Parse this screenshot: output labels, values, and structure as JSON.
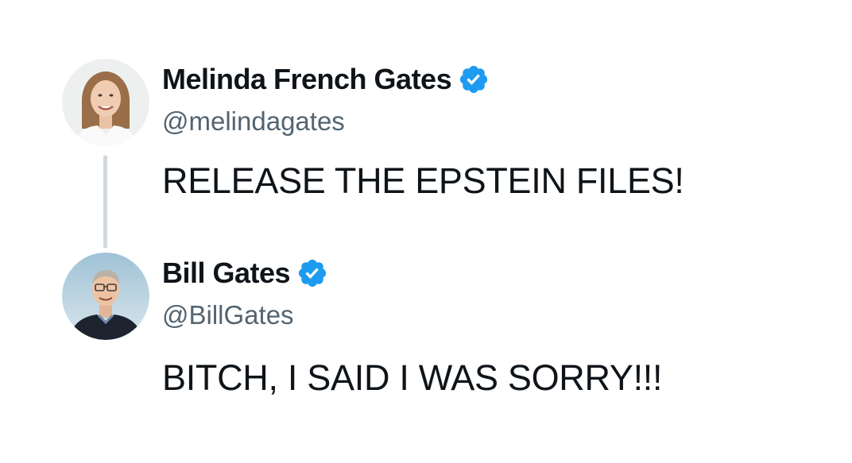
{
  "thread": {
    "tweets": [
      {
        "display_name": "Melinda French Gates",
        "handle": "@melindagates",
        "text": "RELEASE THE EPSTEIN FILES!",
        "verified": true,
        "avatar_icon": "avatar-photo"
      },
      {
        "display_name": "Bill Gates",
        "handle": "@BillGates",
        "text": "BITCH, I SAID I WAS SORRY!!!",
        "verified": true,
        "avatar_icon": "avatar-photo"
      }
    ]
  },
  "colors": {
    "verified_blue": "#1d9bf0",
    "handle_gray": "#536471",
    "text_black": "#0f1419",
    "thread_line": "#cfd9de"
  }
}
